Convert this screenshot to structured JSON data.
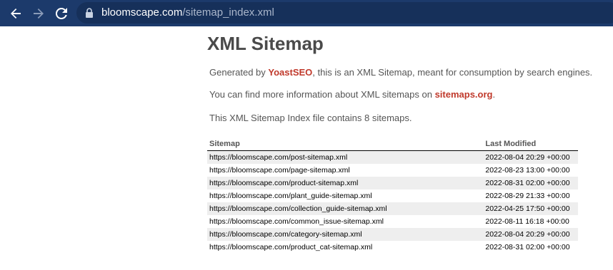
{
  "browser": {
    "url_host": "bloomscape.com",
    "url_path": "/sitemap_index.xml"
  },
  "page": {
    "title": "XML Sitemap",
    "intro_prefix": "Generated by ",
    "intro_link": "YoastSEO",
    "intro_suffix": ", this is an XML Sitemap, meant for consumption by search engines.",
    "info_prefix": "You can find more information about XML sitemaps on ",
    "info_link": "sitemaps.org",
    "info_suffix": ".",
    "count_text": "This XML Sitemap Index file contains 8 sitemaps."
  },
  "table": {
    "headers": [
      "Sitemap",
      "Last Modified"
    ],
    "rows": [
      {
        "url": "https://bloomscape.com/post-sitemap.xml",
        "modified": "2022-08-04 20:29 +00:00"
      },
      {
        "url": "https://bloomscape.com/page-sitemap.xml",
        "modified": "2022-08-23 13:00 +00:00"
      },
      {
        "url": "https://bloomscape.com/product-sitemap.xml",
        "modified": "2022-08-31 02:00 +00:00"
      },
      {
        "url": "https://bloomscape.com/plant_guide-sitemap.xml",
        "modified": "2022-08-29 21:33 +00:00"
      },
      {
        "url": "https://bloomscape.com/collection_guide-sitemap.xml",
        "modified": "2022-04-25 17:50 +00:00"
      },
      {
        "url": "https://bloomscape.com/common_issue-sitemap.xml",
        "modified": "2022-08-11 16:18 +00:00"
      },
      {
        "url": "https://bloomscape.com/category-sitemap.xml",
        "modified": "2022-08-04 20:29 +00:00"
      },
      {
        "url": "https://bloomscape.com/product_cat-sitemap.xml",
        "modified": "2022-08-31 02:00 +00:00"
      }
    ]
  },
  "colors": {
    "toolbar": "#1c3a6b",
    "link": "#c0392b",
    "row_alt": "#eeeeee"
  },
  "icons": [
    "back-arrow-icon",
    "forward-arrow-icon",
    "reload-icon",
    "lock-icon"
  ]
}
